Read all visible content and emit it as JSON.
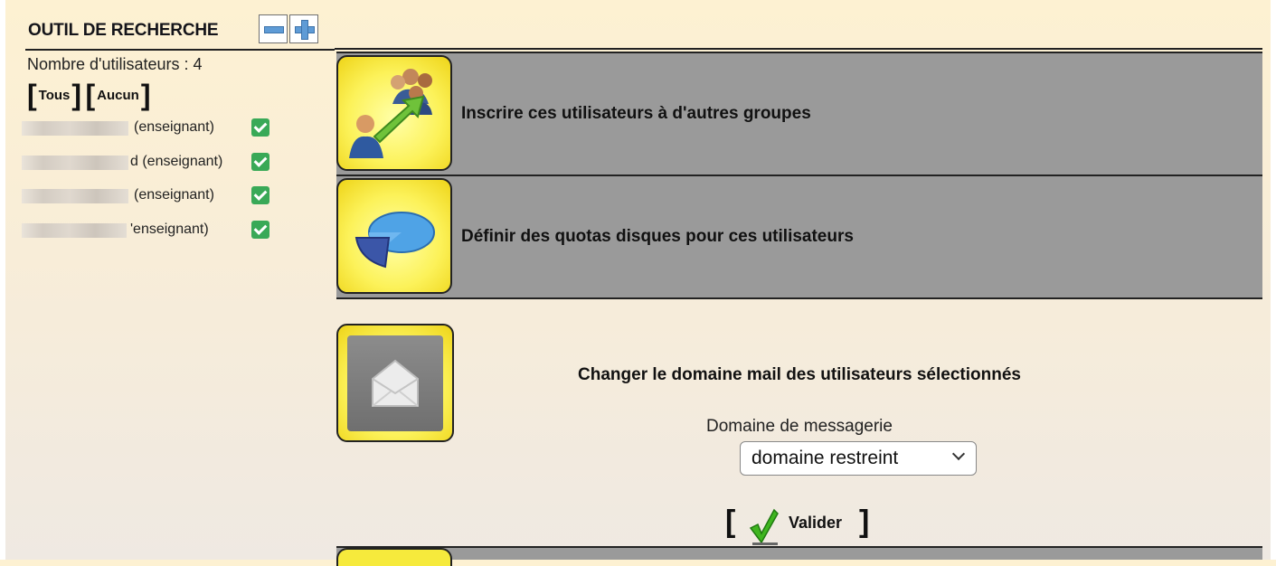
{
  "tool": {
    "title": "OUTIL DE RECHERCHE",
    "count_label": "Nombre d'utilisateurs : 4",
    "all_label": "Tous",
    "none_label": "Aucun"
  },
  "users": [
    {
      "role": "(enseignant)",
      "checked": true
    },
    {
      "role": "d (enseignant)",
      "checked": true
    },
    {
      "role": "(enseignant)",
      "checked": true
    },
    {
      "role": "'enseignant)",
      "checked": true
    }
  ],
  "actions": {
    "register_groups": "Inscrire ces utilisateurs à d'autres groupes",
    "disk_quotas": "Définir des quotas disques pour ces utilisateurs"
  },
  "mail": {
    "title": "Changer le domaine mail des utilisateurs sélectionnés",
    "domain_label": "Domaine de messagerie",
    "domain_value": "domaine restreint",
    "validate_label": "Valider"
  },
  "colors": {
    "row_gray": "#9a9a9a",
    "tile_yellow": "#fcf25a",
    "check_green": "#39a957"
  }
}
